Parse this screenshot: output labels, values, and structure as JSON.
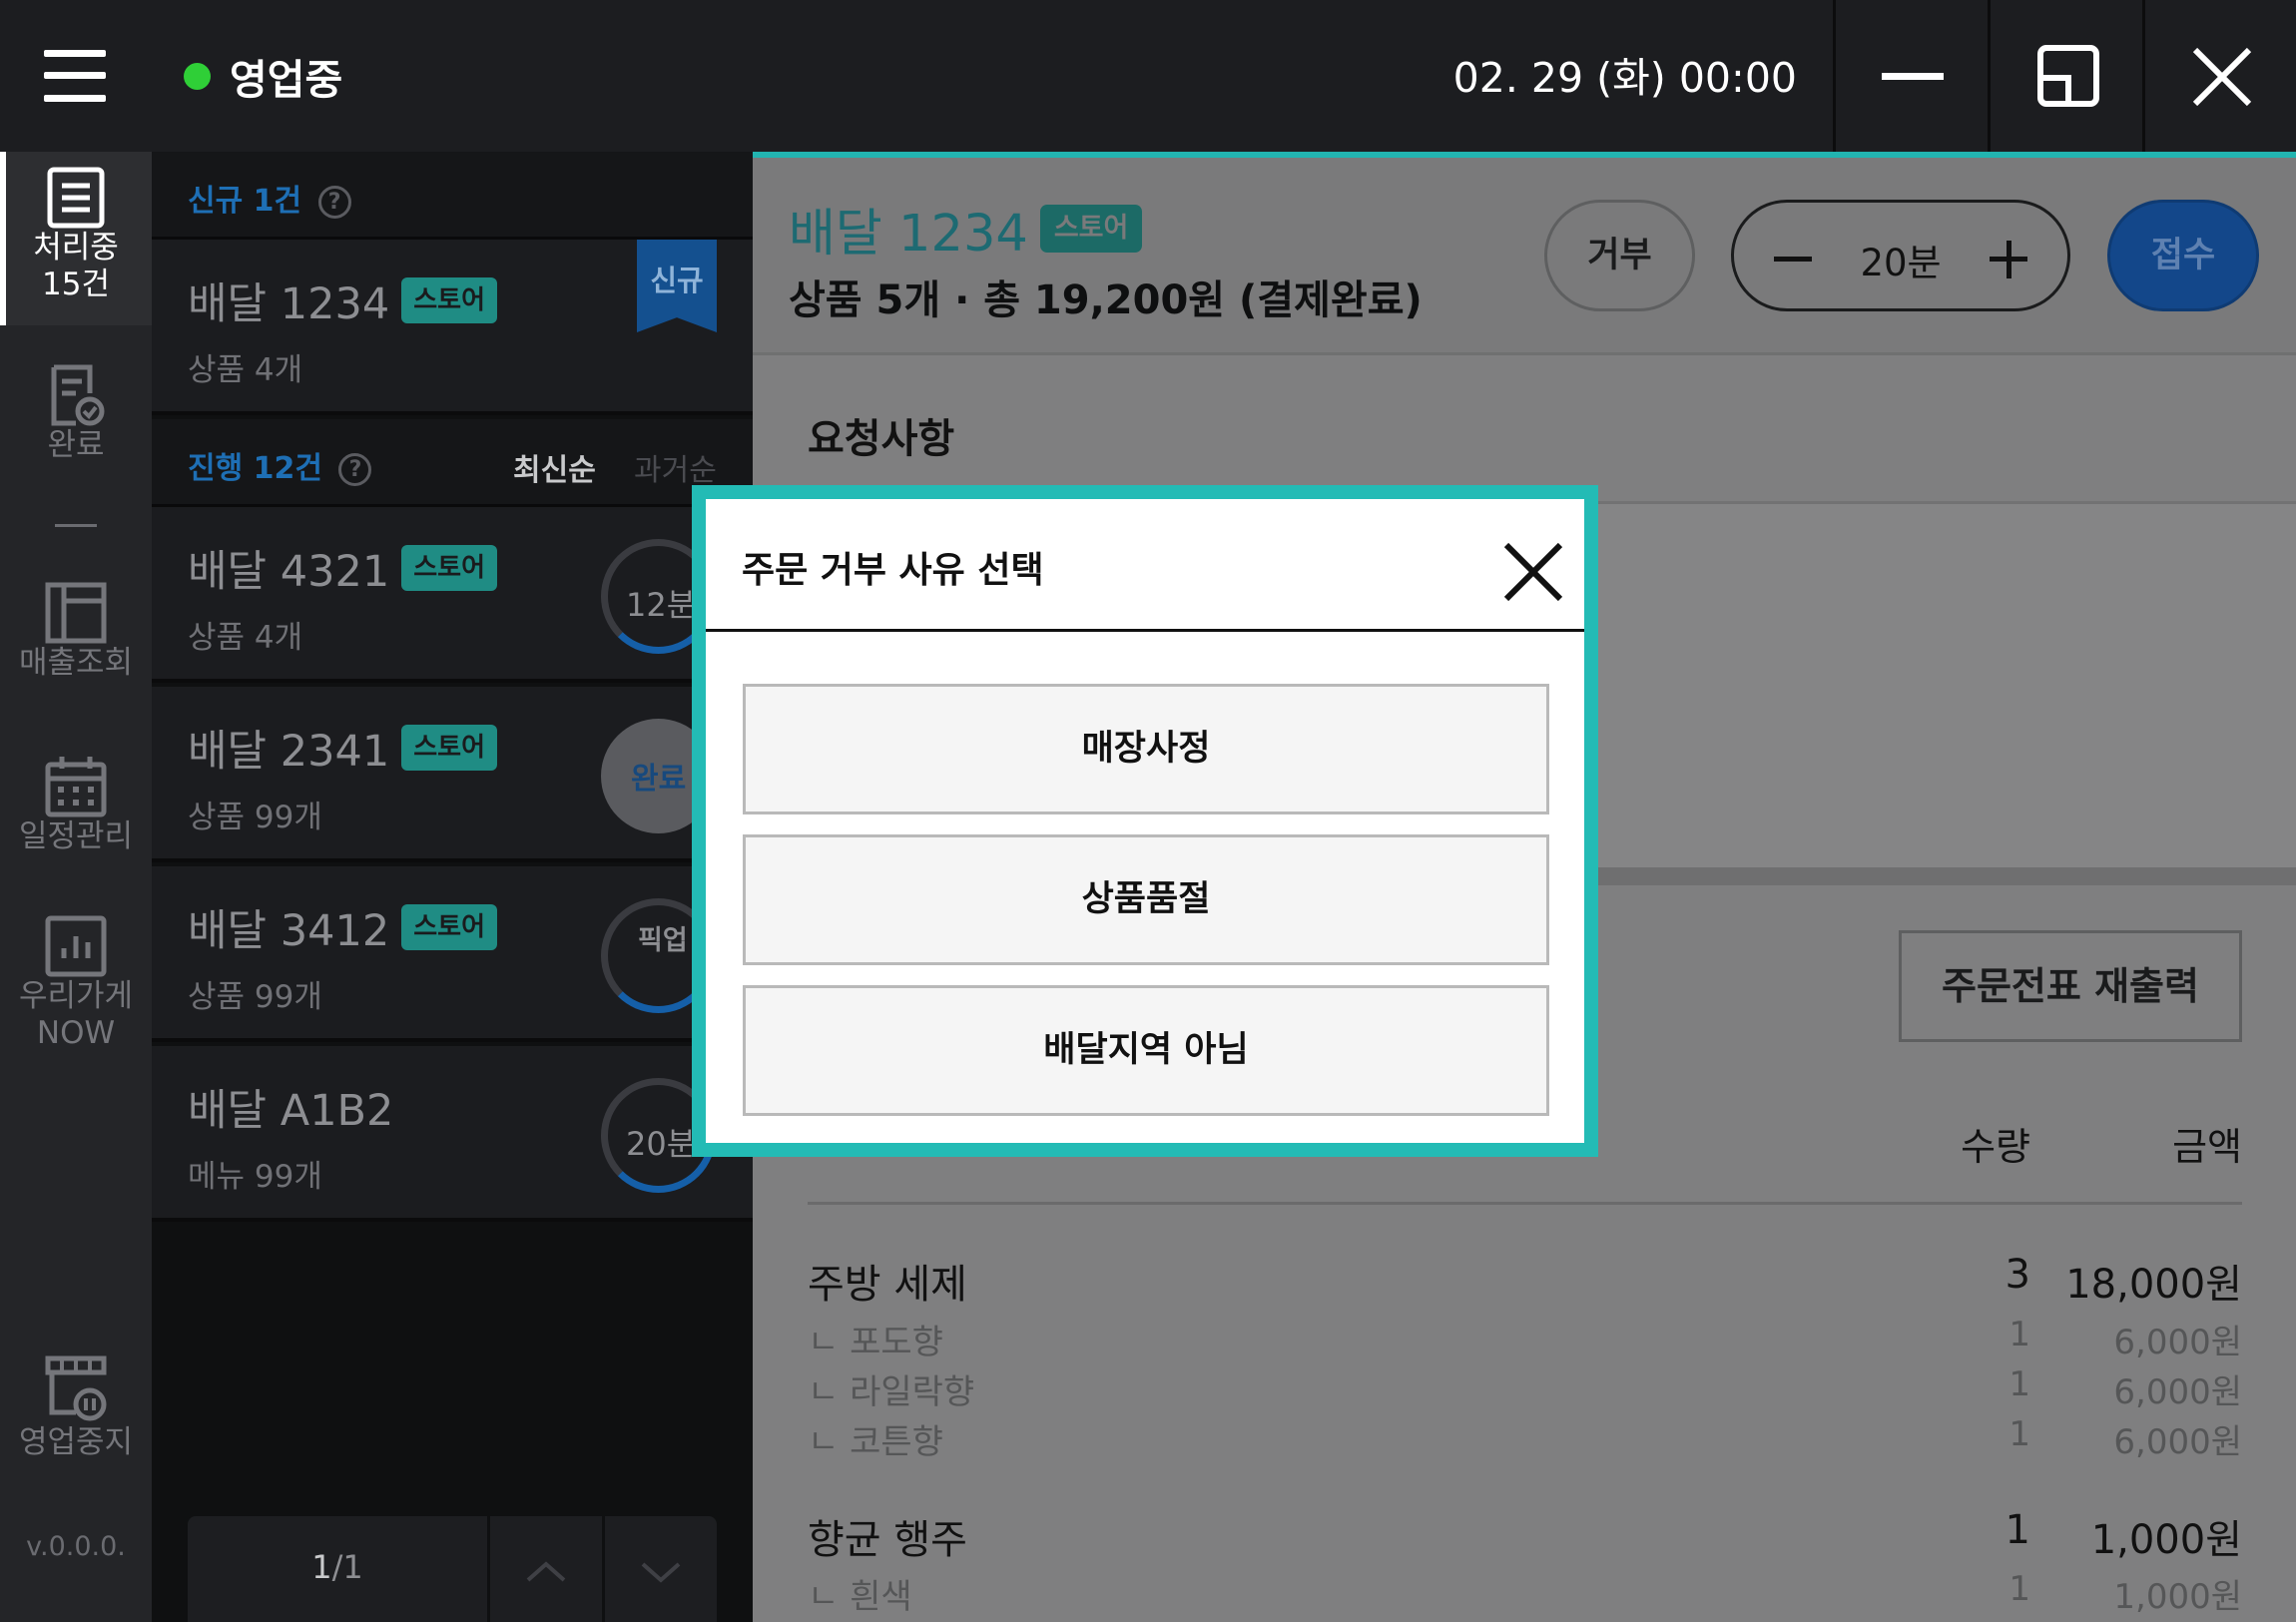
{
  "topbar": {
    "status_label": "영업중",
    "status_color": "#2fcf37",
    "datetime": "02. 29 (화) 00:00",
    "window_controls": [
      "minimize-icon",
      "restore-icon",
      "close-icon"
    ]
  },
  "sidebar": {
    "items": [
      {
        "label": "처리중",
        "count": "15건",
        "icon": "receipt-icon",
        "active": true
      },
      {
        "label": "완료",
        "icon": "document-check-icon"
      },
      {
        "label": "매출조회",
        "icon": "ledger-icon"
      },
      {
        "label": "일정관리",
        "icon": "calendar-icon"
      },
      {
        "label": "우리가게",
        "label2": "NOW",
        "icon": "bar-chart-icon"
      },
      {
        "label": "영업중지",
        "icon": "store-pause-icon"
      }
    ],
    "version": "v.0.0.0."
  },
  "list": {
    "new_section": {
      "title": "신규 1건"
    },
    "progress_section": {
      "title": "진행 12건",
      "sort_new": "최신순",
      "sort_old": "과거순"
    },
    "new_orders": [
      {
        "title": "배달 1234",
        "badge": "스토어",
        "sub": "상품 4개",
        "ribbon": "신규"
      }
    ],
    "orders": [
      {
        "title": "배달 4321",
        "badge": "스토어",
        "sub": "상품 4개",
        "status": "12분"
      },
      {
        "title": "배달 2341",
        "badge": "스토어",
        "sub": "상품 99개",
        "status": "완료"
      },
      {
        "title": "배달 3412",
        "badge": "스토어",
        "sub": "상품 99개",
        "status": "픽업 대기"
      },
      {
        "title": "배달 A1B2",
        "sub": "메뉴 99개",
        "status": "20분"
      }
    ],
    "pager": {
      "current": "1",
      "total": "/1"
    }
  },
  "detail": {
    "title": "배달 1234",
    "badge": "스토어",
    "summary": "상품 5개 · 총 19,200원 (결제완료)",
    "reject_label": "거부",
    "time_value": "20분",
    "accept_label": "접수",
    "request_title": "요청사항",
    "reprint_label": "주문전표 재출력",
    "columns": {
      "qty": "수량",
      "amount": "금액"
    },
    "items": [
      {
        "name": "주방 세제",
        "qty": "3",
        "amount": "18,000원",
        "options": [
          {
            "name": "ㄴ 포도향",
            "qty": "1",
            "amount": "6,000원"
          },
          {
            "name": "ㄴ 라일락향",
            "qty": "1",
            "amount": "6,000원"
          },
          {
            "name": "ㄴ 코튼향",
            "qty": "1",
            "amount": "6,000원"
          }
        ]
      },
      {
        "name": "향균 행주",
        "qty": "1",
        "amount": "1,000원",
        "options": [
          {
            "name": "ㄴ 흰색",
            "qty": "1",
            "amount": "1,000원"
          }
        ]
      }
    ]
  },
  "modal": {
    "title": "주문 거부 사유 선택",
    "reasons": [
      "매장사정",
      "상품품절",
      "배달지역 아님"
    ],
    "accent_color": "#23bbb5"
  }
}
